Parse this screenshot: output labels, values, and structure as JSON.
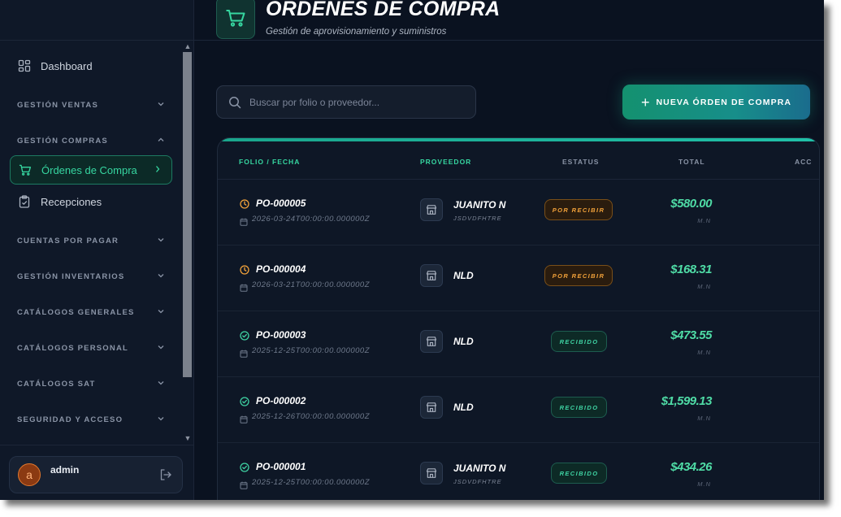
{
  "header": {
    "title": "ÓRDENES DE COMPRA",
    "subtitle": "Gestión de aprovisionamiento y suministros"
  },
  "sidebar": {
    "dashboard": "Dashboard",
    "sections": {
      "ventas": "GESTIÓN VENTAS",
      "compras": "GESTIÓN COMPRAS",
      "cxp": "CUENTAS POR PAGAR",
      "inventarios": "GESTIÓN INVENTARIOS",
      "catalogos_generales": "CATÁLOGOS GENERALES",
      "catalogos_personal": "CATÁLOGOS PERSONAL",
      "catalogos_sat": "CATÁLOGOS SAT",
      "seguridad": "SEGURIDAD Y ACCESO"
    },
    "compras_items": [
      "Órdenes de Compra",
      "Recepciones"
    ],
    "user": {
      "initial": "a",
      "name": "admin"
    }
  },
  "search": {
    "placeholder": "Buscar por folio o proveedor...",
    "value": ""
  },
  "actions": {
    "new_order": "NUEVA ÓRDEN DE COMPRA"
  },
  "table": {
    "columns": [
      "FOLIO / FECHA",
      "PROVEEDOR",
      "ESTATUS",
      "TOTAL",
      "ACC"
    ],
    "rows": [
      {
        "status_kind": "pending",
        "folio": "PO-000005",
        "date": "2026-03-24T00:00:00.000000Z",
        "provider": "JUANITO N",
        "rfc": "JSDVDFHTRE",
        "status": "POR RECIBIR",
        "total": "$580.00",
        "currency": "M.N"
      },
      {
        "status_kind": "pending",
        "folio": "PO-000004",
        "date": "2026-03-21T00:00:00.000000Z",
        "provider": "NLD",
        "rfc": "",
        "status": "POR RECIBIR",
        "total": "$168.31",
        "currency": "M.N"
      },
      {
        "status_kind": "done",
        "folio": "PO-000003",
        "date": "2025-12-25T00:00:00.000000Z",
        "provider": "NLD",
        "rfc": "",
        "status": "RECIBIDO",
        "total": "$473.55",
        "currency": "M.N"
      },
      {
        "status_kind": "done",
        "folio": "PO-000002",
        "date": "2025-12-26T00:00:00.000000Z",
        "provider": "NLD",
        "rfc": "",
        "status": "RECIBIDO",
        "total": "$1,599.13",
        "currency": "M.N"
      },
      {
        "status_kind": "done",
        "folio": "PO-000001",
        "date": "2025-12-25T00:00:00.000000Z",
        "provider": "JUANITO N",
        "rfc": "JSDVDFHTRE",
        "status": "RECIBIDO",
        "total": "$434.26",
        "currency": "M.N"
      }
    ]
  },
  "colors": {
    "accent": "#36d6a0",
    "pending": "#f2a23a",
    "background": "#0a1220"
  }
}
